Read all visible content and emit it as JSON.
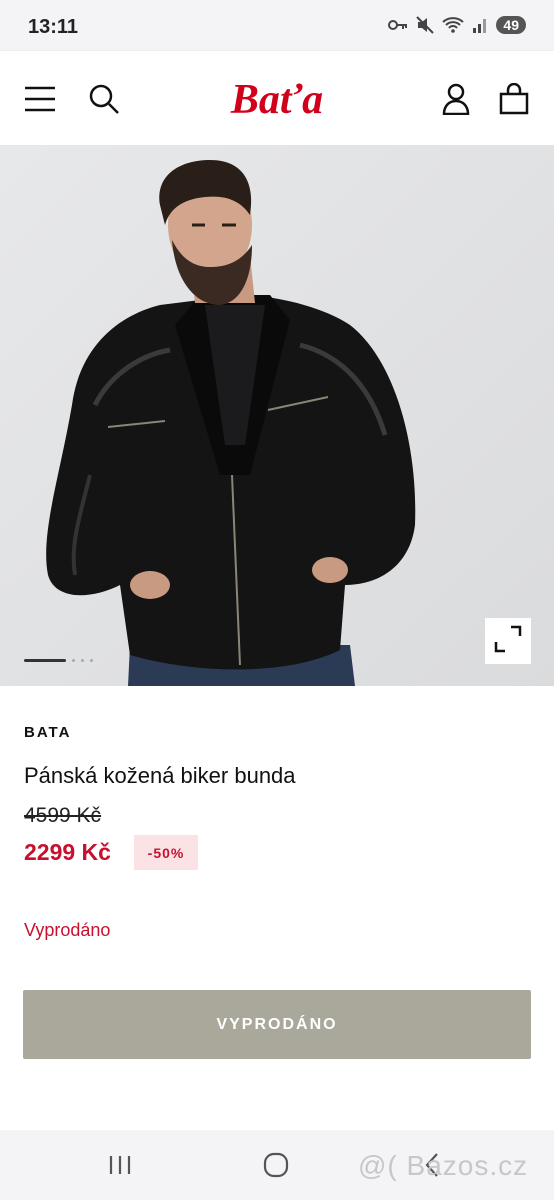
{
  "status_bar": {
    "time": "13:11",
    "battery": "49",
    "icons": [
      "key-icon",
      "mute-icon",
      "wifi-icon",
      "signal-icon"
    ]
  },
  "header": {
    "logo_text": "Baťa",
    "icons": [
      "menu-icon",
      "search-icon",
      "account-icon",
      "cart-icon"
    ],
    "brand_color": "#d0021b"
  },
  "hero": {
    "image": "man-in-black-leather-biker-jacket",
    "carousel": {
      "active_index": 1,
      "total": 3
    }
  },
  "product": {
    "brand": "BATA",
    "title": "Pánská kožená biker bunda",
    "old_price": "4599 Kč",
    "price": "2299 Kč",
    "discount": "-50%",
    "availability": "Vyprodáno",
    "cta_label": "VYPRODÁNO",
    "accent_color": "#c8102e",
    "cta_color": "#a9a89a"
  },
  "nav_bar": {
    "icons": [
      "recent-apps-icon",
      "home-icon",
      "back-icon"
    ]
  },
  "watermark": "@( Bazos.cz"
}
